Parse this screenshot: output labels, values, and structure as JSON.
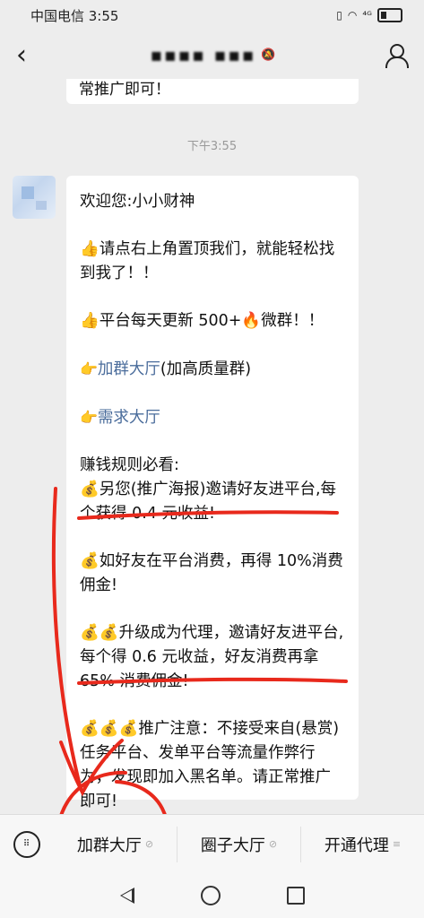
{
  "status_bar": {
    "carrier_time": "中国电信 3:55",
    "signal_text": "⁴ᴳ"
  },
  "header": {
    "title": "▪▪▪▪ ▪▪▪",
    "icons": [
      "back-icon",
      "mute-icon",
      "contact-icon"
    ]
  },
  "chat": {
    "previous_message_tail": "常推广即可！",
    "timestamp": "下午3:55",
    "message": {
      "lines": [
        "欢迎您:小小财神",
        "👍请点右上角置顶我们，就能轻松找到我了！！",
        "👍平台每天更新 500+🔥微群！！",
        "加群大厅",
        "(加高质量群)",
        "需求大厅",
        "赚钱规则必看:",
        "💰另您(推广海报)邀请好友进平台,每个获得 0.4 元收益!",
        "💰如好友在平台消费，再得 10%消费佣金!",
        "💰💰升级成为代理，邀请好友进平台,每个得 0.6 元收益，好友消费再拿 65% 消费佣金!",
        "💰💰💰推广注意：不接受来自(悬赏)任务平台、发单平台等流量作弊行为，发现即加入黑名单。请正常推广即可!"
      ],
      "point_emoji": "👉"
    }
  },
  "bottom_menu": {
    "items": [
      {
        "label": "加群大厅",
        "icon": "link-icon"
      },
      {
        "label": "圈子大厅",
        "icon": "compass-icon"
      },
      {
        "label": "开通代理",
        "icon": "menu-icon"
      }
    ]
  },
  "colors": {
    "background": "#ededed",
    "link": "#4a6c9b",
    "annotation": "#e8291c"
  }
}
